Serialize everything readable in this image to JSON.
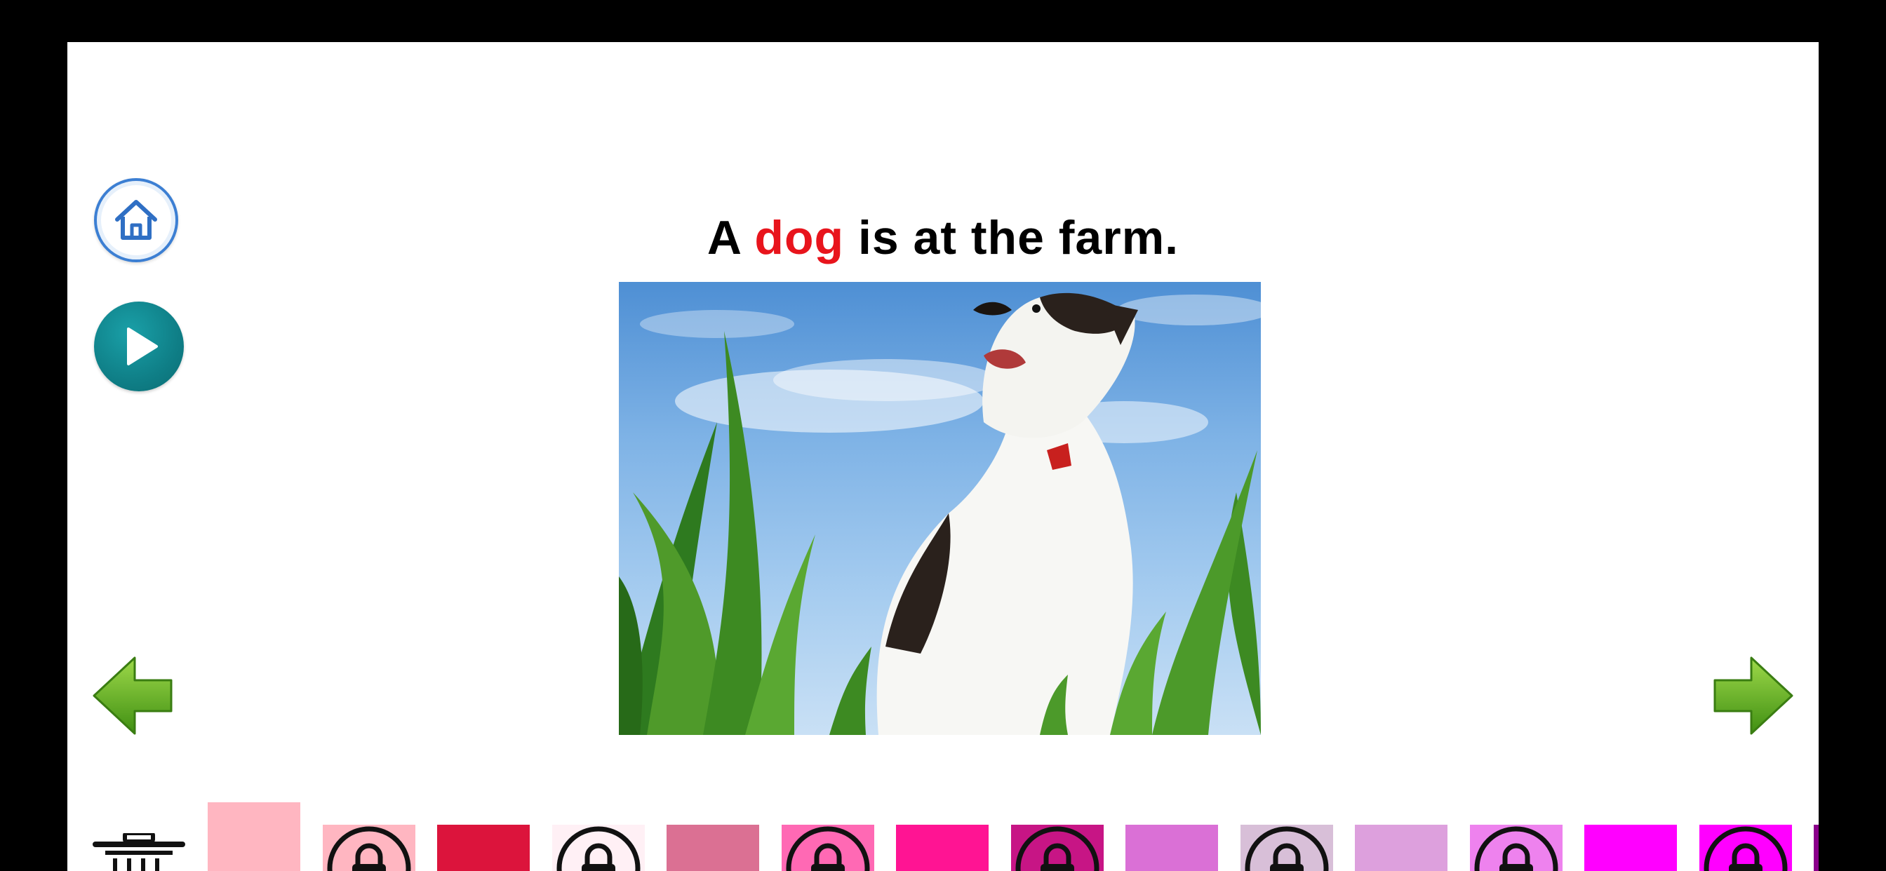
{
  "sentence": {
    "before": "A",
    "keyword": "dog",
    "after": "is at the farm."
  },
  "photo": {
    "subject": "dog sitting in tall grass under a blue sky"
  },
  "sidebar": {
    "home_icon": "house-icon",
    "play_icon": "play-icon"
  },
  "navigation": {
    "prev_icon": "green-left-arrow-icon",
    "next_icon": "green-right-arrow-icon"
  },
  "palette": {
    "trash_icon": "trash-icon",
    "swatches": [
      {
        "color": "#ffb6c1",
        "locked": false,
        "selected": true
      },
      {
        "color": "#ffb6c1",
        "locked": true
      },
      {
        "color": "#dc143c",
        "locked": false
      },
      {
        "color": "#fff0f5",
        "locked": true
      },
      {
        "color": "#db7093",
        "locked": false
      },
      {
        "color": "#ff69b4",
        "locked": true
      },
      {
        "color": "#ff1493",
        "locked": false
      },
      {
        "color": "#c71585",
        "locked": true
      },
      {
        "color": "#da70d6",
        "locked": false
      },
      {
        "color": "#d8bfd8",
        "locked": true
      },
      {
        "color": "#dda0dd",
        "locked": false
      },
      {
        "color": "#ee82ee",
        "locked": true
      },
      {
        "color": "#ff00ff",
        "locked": false
      },
      {
        "color": "#ff00ff",
        "locked": true
      },
      {
        "color": "#8b008b",
        "locked": false
      }
    ]
  },
  "colors": {
    "keyword": "#e8141c",
    "home_ring": "#3c7fd3",
    "play": "#0f7f87",
    "arrow": "#5fae1f"
  }
}
